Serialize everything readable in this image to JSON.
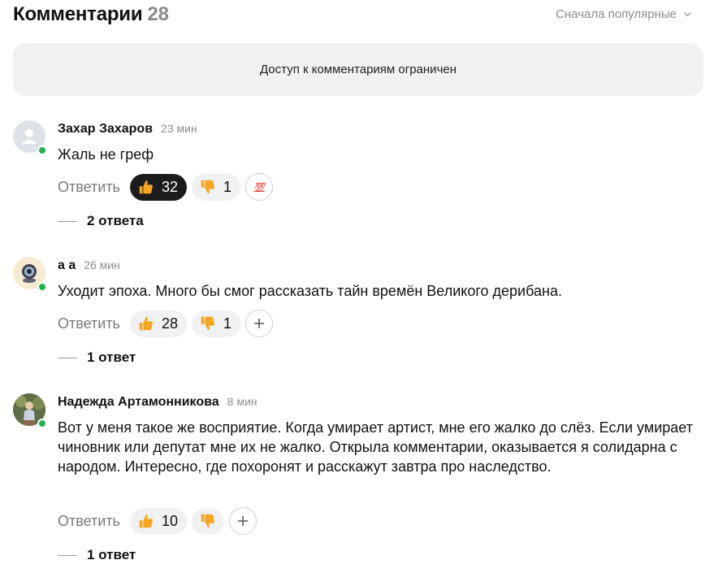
{
  "header": {
    "title": "Комментарии",
    "count": "28",
    "sort_label": "Сначала популярные"
  },
  "notice": {
    "text": "Доступ к комментариям ограничен"
  },
  "comments": [
    {
      "author": "Захар Захаров",
      "time": "23 мин",
      "text": "Жаль не греф",
      "reply_label": "Ответить",
      "likes": "32",
      "dislikes": "1",
      "extra_reaction": "💯",
      "replies_label": "2 ответа"
    },
    {
      "author": "а а",
      "time": "26 мин",
      "text": "Уходит эпоха. Много бы смог рассказать тайн времён Великого дерибана.",
      "reply_label": "Ответить",
      "likes": "28",
      "dislikes": "1",
      "replies_label": "1 ответ"
    },
    {
      "author": "Надежда Артамонникова",
      "time": "8 мин",
      "text": "Вот у меня такое же восприятие. Когда умирает артист, мне его жалко до слёз. Если умирает чиновник или депутат мне их не жалко. Открыла комментарии, оказывается я солидарна с народом. Интересно, где похоронят и расскажут завтра про наследство.",
      "reply_label": "Ответить",
      "likes": "10",
      "replies_label": "1 ответ"
    }
  ],
  "colors": {
    "online": "#23b14d",
    "pill_bg": "#f0f1f3",
    "active_pill": "#1c1c1e",
    "thumb": "#f5a623"
  }
}
